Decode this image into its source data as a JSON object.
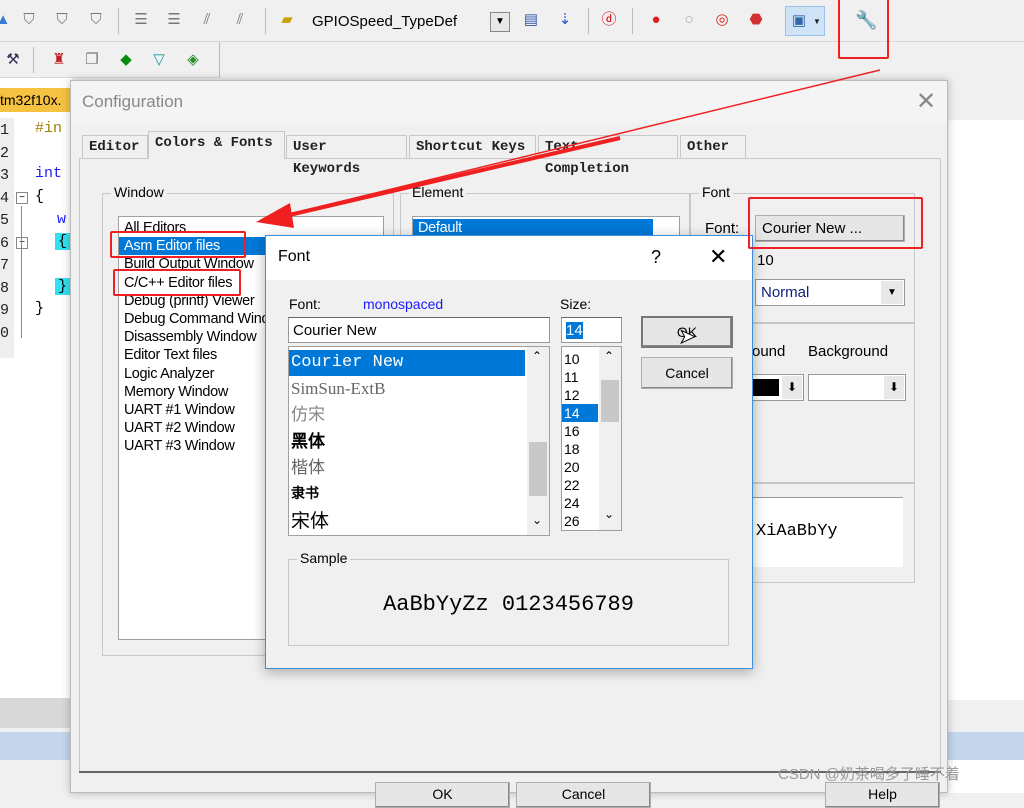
{
  "toolbar": {
    "combo_value": "GPIOSpeed_TypeDef",
    "icons": [
      "bookmark-icon",
      "bookmark-prev-icon",
      "bookmark-next-icon",
      "indent-icon",
      "unindent-icon",
      "comment-icon",
      "uncomment-icon",
      "find-in-files-icon",
      "dropdown-icon",
      "build-icon",
      "download-icon",
      "debug-icon",
      "breakpoint-icon",
      "breakpoint-disable-icon",
      "breakpoint-kill-icon",
      "window-layout-icon",
      "configuration-wrench-icon"
    ],
    "row2_icons": [
      "wizard-icon",
      "target-options-icon",
      "manage-components-icon",
      "pack-installer-icon",
      "runtime-env-icon",
      "event-recorder-icon"
    ]
  },
  "editor": {
    "tab_label": "tm32f10x.",
    "line_numbers": [
      "1",
      "2",
      "3",
      "4",
      "5",
      "6",
      "7",
      "8",
      "9",
      "0"
    ],
    "code_fragments": [
      "#in",
      "int",
      "{",
      "w",
      "{",
      "}",
      "}"
    ]
  },
  "config": {
    "title": "Configuration",
    "tabs": [
      "Editor",
      "Colors & Fonts",
      "User Keywords",
      "Shortcut Keys",
      "Text Completion",
      "Other"
    ],
    "active_tab": "Colors & Fonts",
    "window_group": "Window",
    "window_items": [
      "All Editors",
      "Asm Editor files",
      "Build Output Window",
      "C/C++ Editor files",
      "Debug (printf) Viewer",
      "Debug Command Window",
      "Disassembly Window",
      "Editor Text files",
      "Logic Analyzer",
      "Memory Window",
      "UART #1 Window",
      "UART #2 Window",
      "UART #3 Window"
    ],
    "window_selected": "Asm Editor files",
    "element_group": "Element",
    "element_items": [
      "Default"
    ],
    "font_group": "Font",
    "font_label": "Font:",
    "font_button": "Courier New ...",
    "font_size": "10",
    "style_value": "Normal",
    "foreground_label": "ound",
    "background_label": "Background",
    "sample_text": "XiAaBbYy",
    "buttons": [
      "OK",
      "Cancel",
      "Help"
    ]
  },
  "font_dialog": {
    "title": "Font",
    "help": "?",
    "font_label": "Font:",
    "font_hint": "monospaced",
    "size_label": "Size:",
    "font_value": "Courier New",
    "size_value": "14",
    "fonts": [
      "Courier New",
      "SimSun-ExtB",
      "仿宋",
      "黑体",
      "楷体",
      "隶书",
      "宋体"
    ],
    "font_selected": "Courier New",
    "sizes": [
      "10",
      "11",
      "12",
      "14",
      "16",
      "18",
      "20",
      "22",
      "24",
      "26"
    ],
    "size_selected": "14",
    "ok": "OK",
    "cancel": "Cancel",
    "sample_label": "Sample",
    "sample_text": "AaBbYyZz 0123456789"
  },
  "colors": {
    "selection": "#0078d7",
    "annotation": "#f02020",
    "hint": "#1a1aff",
    "dialog_border": "#3c8ee0"
  },
  "watermark": "CSDN @奶茶喝多了睡不着"
}
